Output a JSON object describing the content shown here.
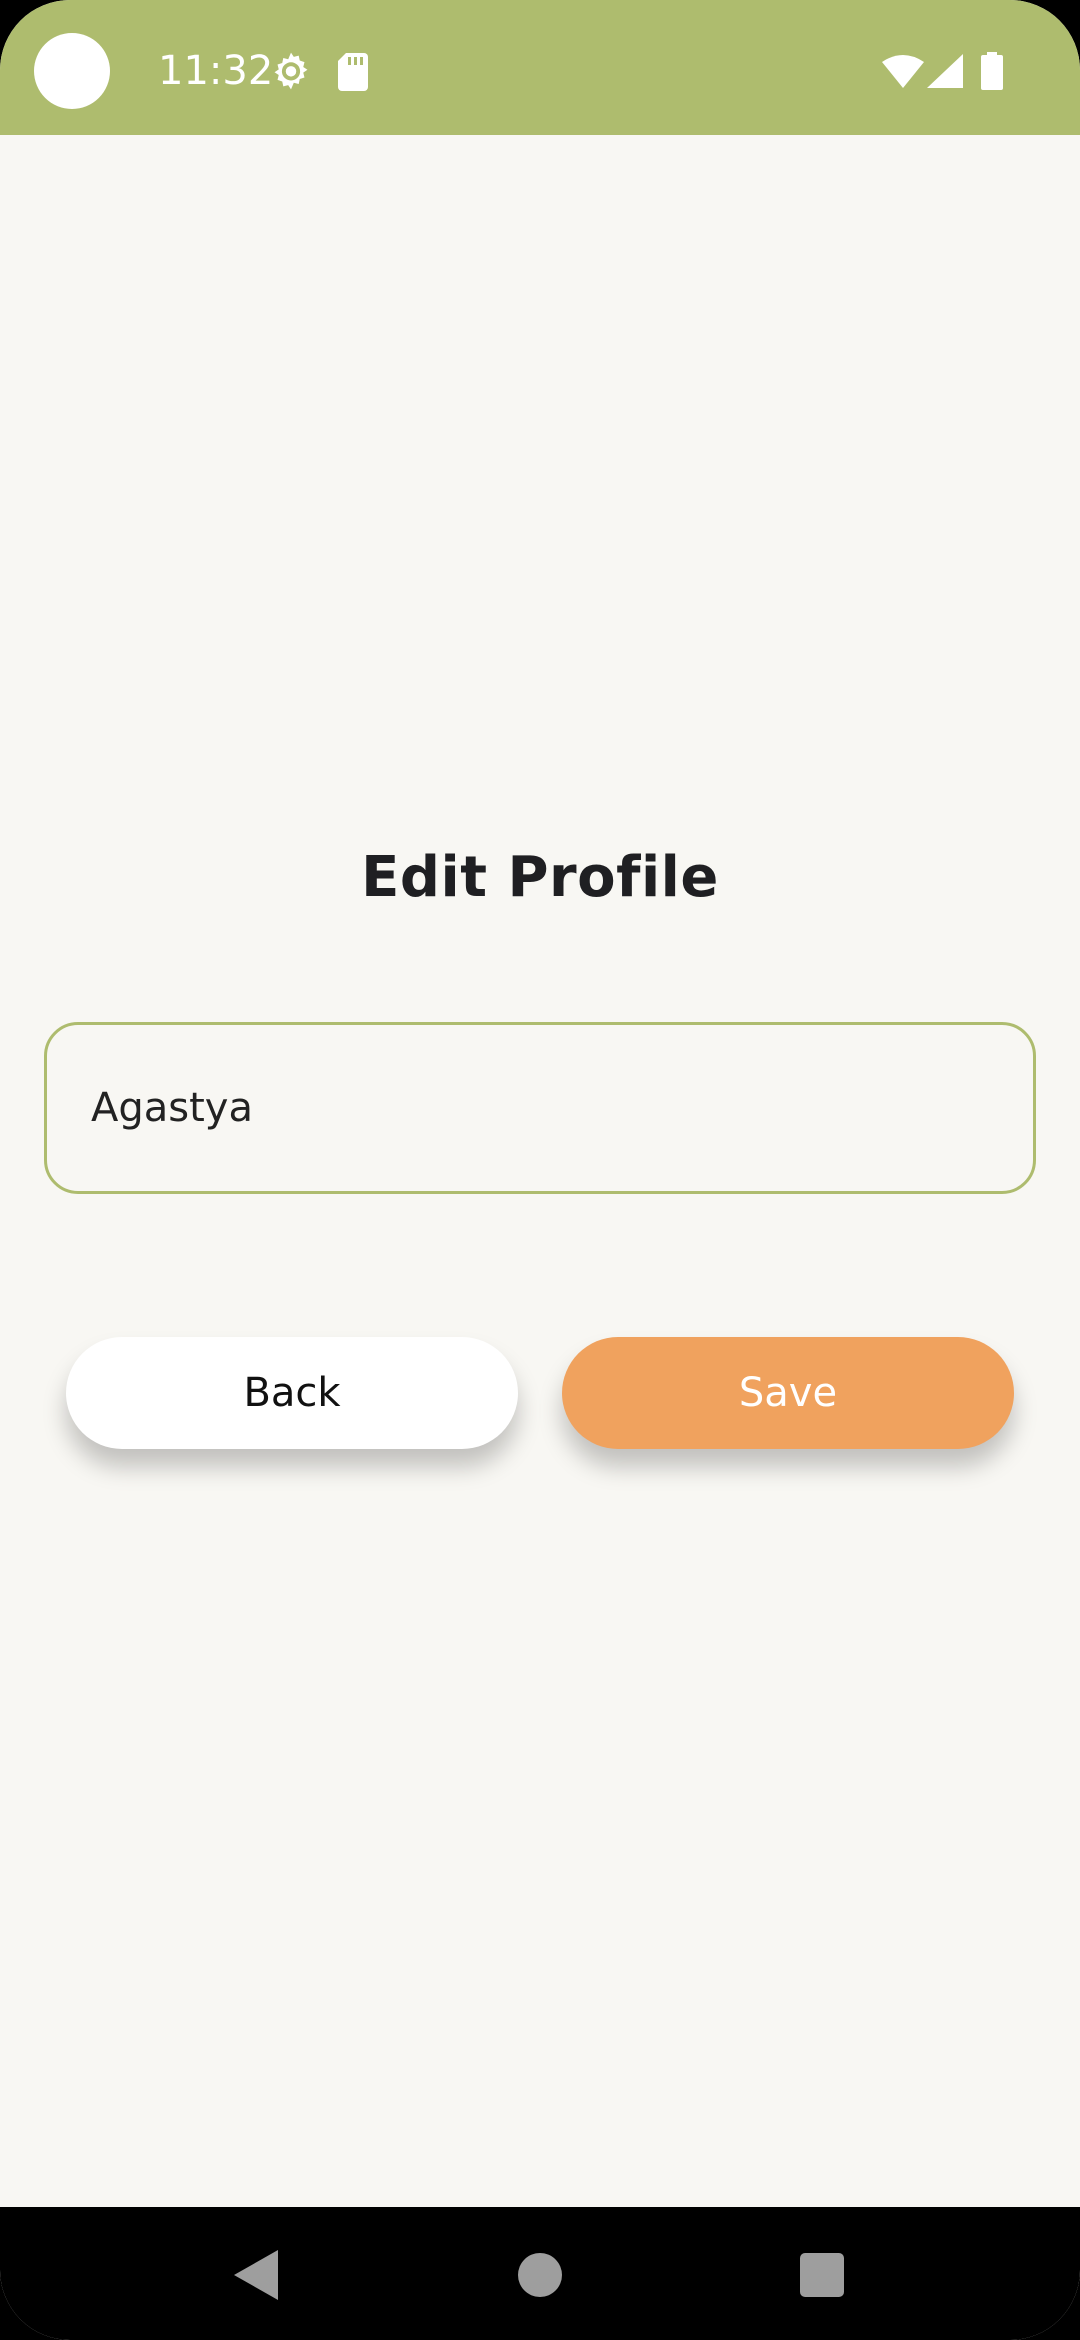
{
  "status_bar": {
    "time": "11:32",
    "icons": [
      "camera-cutout",
      "settings-gear-icon",
      "sd-card-icon",
      "wifi-icon",
      "cell-signal-icon",
      "battery-icon"
    ],
    "color": "#aebc6e"
  },
  "page": {
    "title": "Edit Profile",
    "background": "#f8f7f3"
  },
  "form": {
    "name_value": "Agastya",
    "field_border_color": "#aebc6e"
  },
  "buttons": {
    "back_label": "Back",
    "save_label": "Save",
    "save_color": "#f0a25e"
  },
  "nav_bar": {
    "icons": [
      "back-triangle-icon",
      "home-circle-icon",
      "recents-square-icon"
    ]
  }
}
